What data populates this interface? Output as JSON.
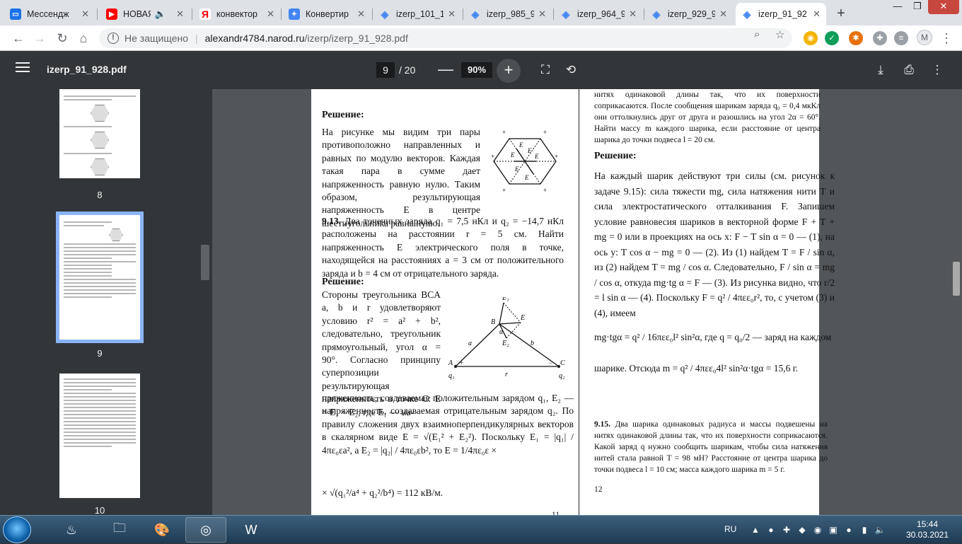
{
  "browser": {
    "tabs": [
      {
        "title": "Мессендж",
        "favicon": "messenger-icon",
        "color": "#1a73e8"
      },
      {
        "title": "НОВАЯ",
        "favicon": "youtube-icon",
        "color": "#ff0000"
      },
      {
        "title": "конвектор",
        "favicon": "yandex-icon",
        "color": "#ffffff"
      },
      {
        "title": "Конвертир",
        "favicon": "puzzle-icon",
        "color": "#4285f4"
      },
      {
        "title": "izerp_101_1",
        "favicon": "doc-icon",
        "color": "#4285f4"
      },
      {
        "title": "izerp_985_9",
        "favicon": "doc-icon",
        "color": "#4285f4"
      },
      {
        "title": "izerp_964_9",
        "favicon": "doc-icon",
        "color": "#4285f4"
      },
      {
        "title": "izerp_929_9",
        "favicon": "doc-icon",
        "color": "#4285f4"
      },
      {
        "title": "izerp_91_92",
        "favicon": "doc-icon",
        "color": "#4285f4"
      }
    ],
    "new_tab": "+",
    "address": {
      "security": "Не защищено",
      "host": "alexandr4784.narod.ru",
      "path": "/izerp/izerp_91_928.pdf"
    },
    "profile_initial": "M"
  },
  "pdf": {
    "filename": "izerp_91_928.pdf",
    "current_page": "9",
    "total_pages": "/ 20",
    "zoom": "90%",
    "thumbnails": [
      {
        "label": "8"
      },
      {
        "label": "9"
      },
      {
        "label": "10"
      }
    ]
  },
  "page": {
    "left": {
      "sol1_title": "Решение:",
      "sol1_text": "На рисунке мы видим три пары противоположно направленных и равных по модулю векторов. Каждая такая пара в сумме дает напряженность равную нулю. Таким образом, результирующая напряженность E в центре шестиугольника равна нулю.",
      "prob_num": "9.13.",
      "prob_text": "Два точечных заряда q₁ = 7,5 нКл и q₂ = −14,7 нКл расположены на расстоянии r = 5 см. Найти напряженность E электрического поля в точке, находящейся на расстояниях a = 3 см от положительного заряда и b = 4 см от отрицательного заряда.",
      "sol2_title": "Решение:",
      "sol2_text_a": "Стороны треугольника BCA a, b и r удовлетворяют условию r² = a² + b², следовательно, треугольник прямоугольный, угол α = 90°. Согласно принципу суперпозиции результирующая напряженность в точке C: E = E₁ + E₂, где E₁ — на-",
      "sol2_text_b": "пряженность, создаваемая положительным зарядом q₁, E₂ — напряженность, создаваемая отрицательным зарядом q₂. По правилу сложения двух взаимноперпендикулярных векторов в скалярном виде E = √(E₁² + E₂²). Поскольку E₁ = |q₁| / 4πε₀εa², а E₂ = |q₂| / 4πε₀εb², то E = 1/4πε₀ε ×",
      "sol2_result": "× √(q₁²/a⁴ + q₂²/b⁴) = 112 кВ/м.",
      "page_num": "11",
      "fig_labels": {
        "B": "B",
        "A": "A",
        "C": "C",
        "q1": "q₁",
        "q2": "q₂",
        "a": "a",
        "b": "b",
        "r": "r",
        "alpha": "α",
        "E": "E",
        "E1": "E₁",
        "E2": "E₂"
      }
    },
    "right": {
      "top_text": "нитях одинаковой длины так, что их поверхности соприкасаются. После сообщения шарикам заряда q₀ = 0,4 мкКл они оттолкнулись друг от друга и разошлись на угол 2α = 60°. Найти массу m каждого шарика, если расстояние от центра шарика до точки подвеса l = 20 см.",
      "sol_title": "Решение:",
      "sol_text": "На каждый шарик действуют три силы (см. рисунок к задаче 9.15): сила тяжести mg, сила натяжения нити T и сила электростатического отталкивания F. Запишем условие равновесия шариков в векторной форме F + T + mg = 0 или в проекциях на ось x: F − T sin α = 0 — (1), на ось y: T cos α − mg = 0 — (2). Из (1) найдем T = F / sin α, из (2) найдем T = mg / cos α. Следовательно, F / sin α = mg / cos α, откуда mg·tg α = F — (3). Из рисунка видно, что r/2 = l sin α — (4). Поскольку F = q² / 4πεε₀r², то, с учетом (3) и (4), имеем",
      "eq1": "mg·tgα = q² / 16πεε₀l² sin²α, где q = q₀/2 — заряд на каждом",
      "eq2": "шарике. Отсюда m = q² / 4πεε₀4l² sin²α·tgα = 15,6 г.",
      "prob_num": "9.15.",
      "prob_text": "Два шарика одинаковых радиуса и массы подвешены на нитях одинаковой длины так, что их поверхности соприкасаются. Какой заряд q нужно сообщить шарикам, чтобы сила натяжения нитей стала равной T = 98 мН? Расстояние от центра шарика до точки подвеса l = 10 см; масса каждого шарика m = 5 г.",
      "page_num": "12"
    }
  },
  "taskbar": {
    "apps": [
      "steam-icon",
      "folder-icon",
      "paint-icon",
      "chrome-icon",
      "word-icon"
    ],
    "lang": "RU",
    "time": "15:44",
    "date": "30.03.2021"
  }
}
